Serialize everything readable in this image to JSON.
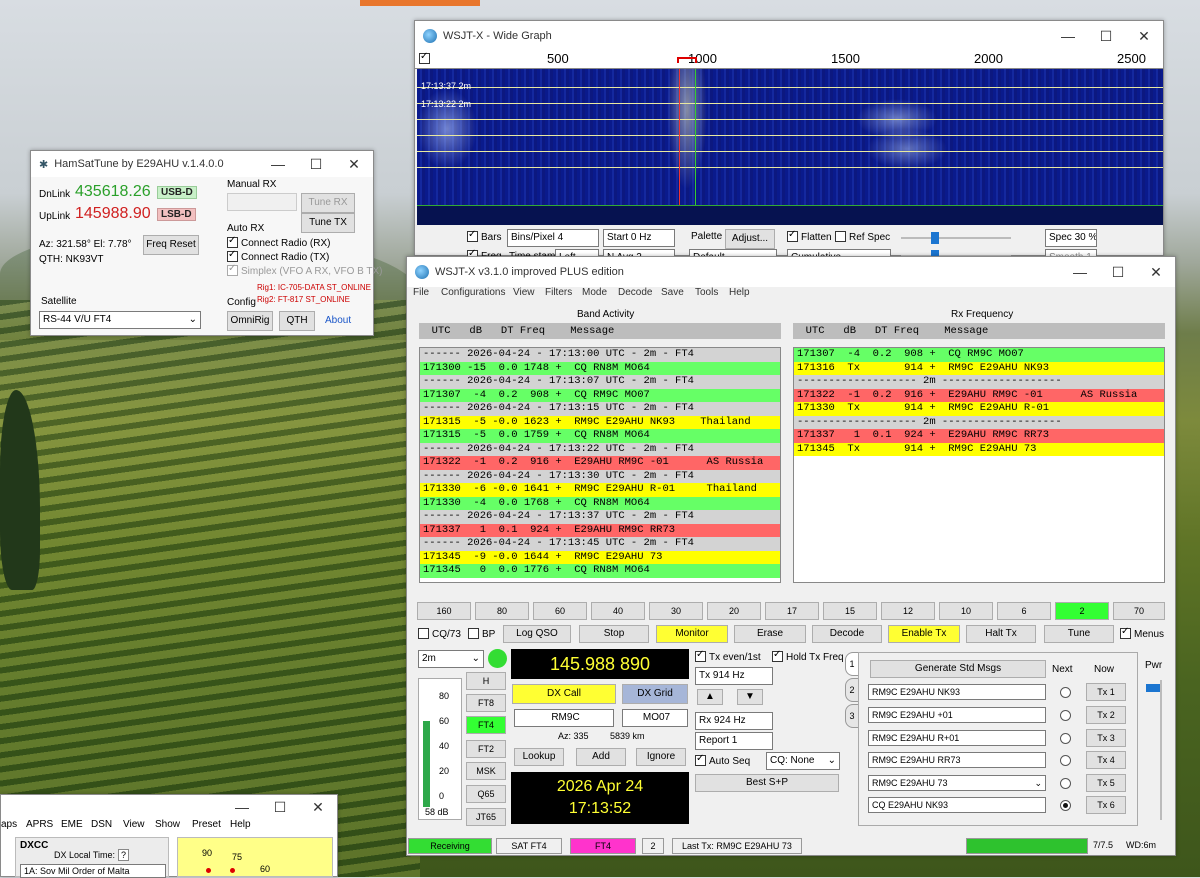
{
  "wide_graph": {
    "title": "WSJT-X - Wide Graph",
    "freq_ticks": [
      "500",
      "1000",
      "1500",
      "2000",
      "2500"
    ],
    "time_labels": [
      "17:13:37  2m",
      "17:13:22  2m"
    ],
    "bars_label": "Bars",
    "freq_label": "Freq",
    "bins_pixel": "Bins/Pixel  4",
    "start": "Start 0 Hz",
    "time_stamp_label": "Time stamp",
    "time_stamp_value": "Left",
    "navg": "N Avg 2",
    "palette_label": "Palette",
    "adjust_label": "Adjust...",
    "palette_value": "Default",
    "flatten_label": "Flatten",
    "refspec_label": "Ref Spec",
    "cumulative": "Cumulative",
    "spec": "Spec 30 %",
    "smooth": "Smooth  1"
  },
  "hamsat": {
    "title": "HamSatTune by E29AHU v.1.4.0.0",
    "dnlink_label": "DnLink",
    "dnlink_value": "435618.26",
    "dnlink_mode": "USB-D",
    "uplink_label": "UpLink",
    "uplink_value": "145988.90",
    "uplink_mode": "LSB-D",
    "az_el": "Az:  321.58°  El:  7.78°",
    "qth": "QTH:  NK93VT",
    "freq_reset": "Freq Reset",
    "manual_rx": "Manual RX",
    "tune_rx": "Tune RX",
    "tune_tx": "Tune TX",
    "auto_rx": "Auto RX",
    "connect_rx": "Connect Radio (RX)",
    "connect_tx": "Connect Radio (TX)",
    "simplex": "Simplex (VFO A RX, VFO B TX)",
    "rig1": "Rig1: IC-705-DATA ST_ONLINE",
    "rig2": "Rig2: FT-817 ST_ONLINE",
    "satellite_label": "Satellite",
    "satellite_value": "RS-44 V/U FT4",
    "config_label": "Config",
    "omnirig": "OmniRig",
    "qth_btn": "QTH",
    "about": "About"
  },
  "wsjtx": {
    "title": "WSJT-X   v3.1.0  improved PLUS edition",
    "menu": [
      "File",
      "Configurations",
      "View",
      "Filters",
      "Mode",
      "Decode",
      "Save",
      "Tools",
      "Help"
    ],
    "band_activity": "Band Activity",
    "rx_frequency": "Rx Frequency",
    "col_header": "  UTC   dB   DT Freq    Message",
    "band_rows": [
      {
        "t": "------ 2026-04-24 - 17:13:00 UTC - 2m - FT4",
        "c": "#d3d3d3"
      },
      {
        "t": "171300 -15  0.0 1748 +  CQ RN8M MO64",
        "c": "#66ff66"
      },
      {
        "t": "------ 2026-04-24 - 17:13:07 UTC - 2m - FT4",
        "c": "#d3d3d3"
      },
      {
        "t": "171307  -4  0.2  908 +  CQ RM9C MO07",
        "c": "#66ff66"
      },
      {
        "t": "------ 2026-04-24 - 17:13:15 UTC - 2m - FT4",
        "c": "#d3d3d3"
      },
      {
        "t": "171315  -5 -0.0 1623 +  RM9C E29AHU NK93    Thailand",
        "c": "#ffff00"
      },
      {
        "t": "171315  -5  0.0 1759 +  CQ RN8M MO64",
        "c": "#66ff66"
      },
      {
        "t": "------ 2026-04-24 - 17:13:22 UTC - 2m - FT4",
        "c": "#d3d3d3"
      },
      {
        "t": "171322  -1  0.2  916 +  E29AHU RM9C -01      AS Russia",
        "c": "#ff6666"
      },
      {
        "t": "------ 2026-04-24 - 17:13:30 UTC - 2m - FT4",
        "c": "#d3d3d3"
      },
      {
        "t": "171330  -6 -0.0 1641 +  RM9C E29AHU R-01     Thailand",
        "c": "#ffff00"
      },
      {
        "t": "171330  -4  0.0 1768 +  CQ RN8M MO64",
        "c": "#66ff66"
      },
      {
        "t": "------ 2026-04-24 - 17:13:37 UTC - 2m - FT4",
        "c": "#d3d3d3"
      },
      {
        "t": "171337   1  0.1  924 +  E29AHU RM9C RR73",
        "c": "#ff6666"
      },
      {
        "t": "------ 2026-04-24 - 17:13:45 UTC - 2m - FT4",
        "c": "#d3d3d3"
      },
      {
        "t": "171345  -9 -0.0 1644 +  RM9C E29AHU 73",
        "c": "#ffff00"
      },
      {
        "t": "171345   0  0.0 1776 +  CQ RN8M MO64",
        "c": "#66ff66"
      }
    ],
    "rx_rows": [
      {
        "t": "171307  -4  0.2  908 +  CQ RM9C MO07",
        "c": "#66ff66"
      },
      {
        "t": "171316  Tx       914 +  RM9C E29AHU NK93",
        "c": "#ffff00"
      },
      {
        "t": "------------------- 2m -------------------",
        "c": "#d3d3d3"
      },
      {
        "t": "171322  -1  0.2  916 +  E29AHU RM9C -01      AS Russia",
        "c": "#ff6666"
      },
      {
        "t": "171330  Tx       914 +  RM9C E29AHU R-01",
        "c": "#ffff00"
      },
      {
        "t": "------------------- 2m -------------------",
        "c": "#d3d3d3"
      },
      {
        "t": "171337   1  0.1  924 +  E29AHU RM9C RR73",
        "c": "#ff6666"
      },
      {
        "t": "171345  Tx       914 +  RM9C E29AHU 73",
        "c": "#ffff00"
      }
    ],
    "bands": [
      "160",
      "80",
      "60",
      "40",
      "30",
      "20",
      "17",
      "15",
      "12",
      "10",
      "6",
      "2",
      "70"
    ],
    "active_band": "2",
    "cq73": "CQ/73",
    "bp": "BP",
    "log_qso": "Log QSO",
    "stop": "Stop",
    "monitor": "Monitor",
    "erase": "Erase",
    "decode": "Decode",
    "enable_tx": "Enable Tx",
    "halt_tx": "Halt Tx",
    "tune": "Tune",
    "menus": "Menus",
    "band_select": "2m",
    "modes": [
      "H",
      "FT8",
      "FT4",
      "FT2",
      "MSK",
      "Q65",
      "JT65"
    ],
    "active_mode": "FT4",
    "meter_ticks": [
      "80",
      "60",
      "40",
      "20",
      "0"
    ],
    "meter_db": "58 dB",
    "frequency": "145.988 890",
    "dx_call_label": "DX Call",
    "dx_grid_label": "DX Grid",
    "dx_call": "RM9C",
    "dx_grid": "MO07",
    "az": "Az: 335",
    "dist": "5839 km",
    "lookup": "Lookup",
    "add": "Add",
    "ignore": "Ignore",
    "date": "2026 Apr 24",
    "time": "17:13:52",
    "tx_even": "Tx even/1st",
    "hold_tx": "Hold Tx Freq",
    "tx_hz": "Tx  914  Hz",
    "rx_hz": "Rx  924  Hz",
    "report": "Report  1",
    "auto_seq": "Auto Seq",
    "cq_none": "CQ: None",
    "best_sp": "Best S+P",
    "gen_std": "Generate Std Msgs",
    "next": "Next",
    "now": "Now",
    "tx_msgs": [
      "RM9C E29AHU NK93",
      "RM9C E29AHU +01",
      "RM9C E29AHU R+01",
      "RM9C E29AHU RR73",
      "RM9C E29AHU 73",
      "CQ E29AHU NK93"
    ],
    "tx_btns": [
      "Tx 1",
      "Tx 2",
      "Tx 3",
      "Tx 4",
      "Tx 5",
      "Tx 6"
    ],
    "pwr": "Pwr",
    "tabs": [
      "1",
      "2",
      "3"
    ],
    "status_receiving": "Receiving",
    "status_mode": "SAT FT4",
    "status_ft4": "FT4",
    "status_num": "2",
    "status_last": "Last Tx: RM9C E29AHU 73",
    "status_tr": "7/7.5",
    "status_wd": "WD:6m"
  },
  "gridtracker": {
    "menu": [
      "aps",
      "APRS",
      "EME",
      "DSN",
      "View",
      "Show",
      "Preset",
      "Help"
    ],
    "dxcc": "DXCC",
    "dx_local_time": "DX Local Time:",
    "q": "?",
    "entry": "1A:  Sov Mil Order of Malta",
    "r1": "90",
    "r2": "75",
    "r3": "60"
  },
  "colors": {
    "green": "#66ff66",
    "yellow": "#ffff00",
    "red": "#ff6666",
    "grey": "#d3d3d3",
    "magenta": "#ff33cc"
  }
}
